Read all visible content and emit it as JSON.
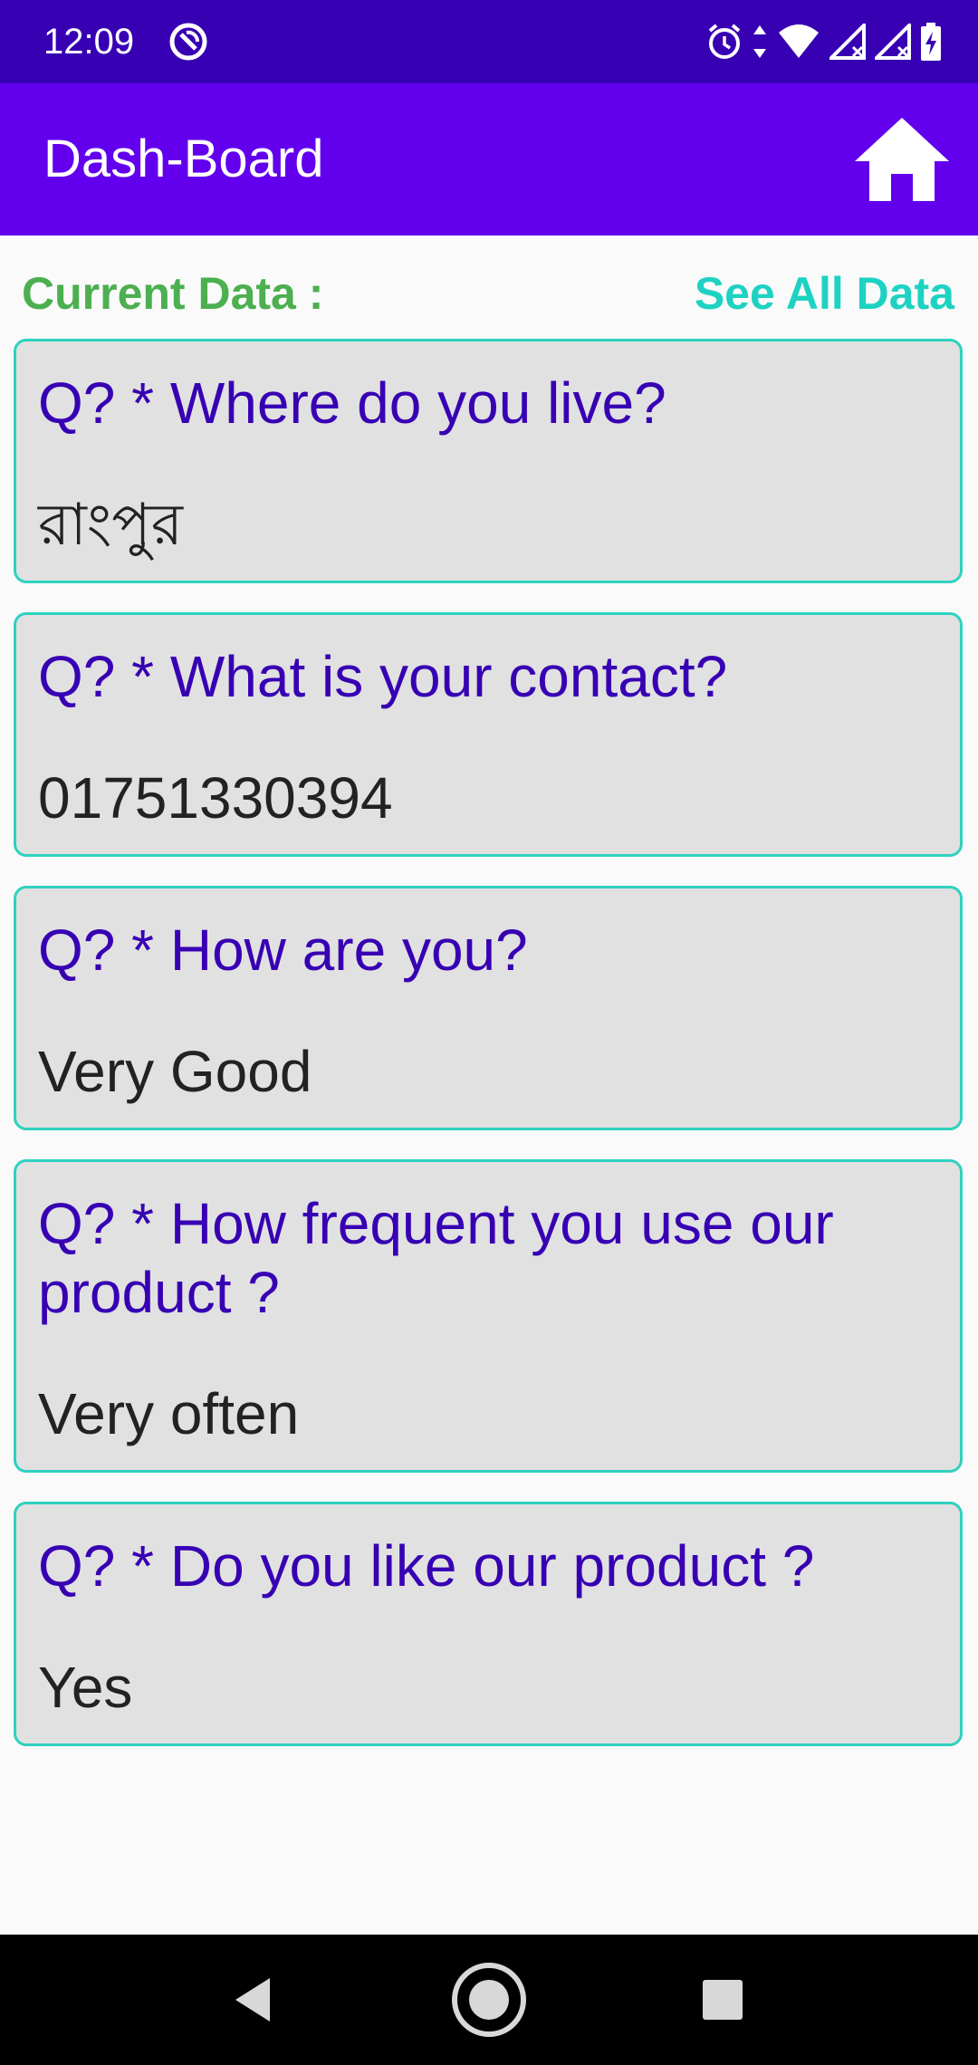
{
  "status_bar": {
    "time": "12:09",
    "left_icon": "sync-disabled-icon",
    "right_icons": [
      "alarm-icon",
      "data-arrows-icon",
      "wifi-icon",
      "signal-icon",
      "signal-icon",
      "battery-charging-icon"
    ]
  },
  "app_bar": {
    "title": "Dash-Board",
    "home_icon": "home-icon"
  },
  "header": {
    "current_label": "Current Data :",
    "see_all_label": "See All Data"
  },
  "cards": [
    {
      "question": "Q? * Where do you live?",
      "answer": "রাংপুর"
    },
    {
      "question": "Q? * What is your contact?",
      "answer": "01751330394"
    },
    {
      "question": "Q? * How are you?",
      "answer": "Very Good"
    },
    {
      "question": "Q? * How frequent you use our product ?",
      "answer": "Very often"
    },
    {
      "question": "Q? * Do you like our product ?",
      "answer": "Yes"
    }
  ],
  "nav_bar": {
    "back_icon": "back-triangle-icon",
    "home_icon": "home-circle-icon",
    "recents_icon": "recents-square-icon"
  },
  "colors": {
    "status_bar": "#3700b3",
    "app_bar": "#6200ee",
    "question_text": "#3700b3",
    "current_label": "#4caf50",
    "see_all": "#1ed2c2",
    "card_border": "#2ed1c0",
    "card_bg": "#e1e1e1"
  }
}
